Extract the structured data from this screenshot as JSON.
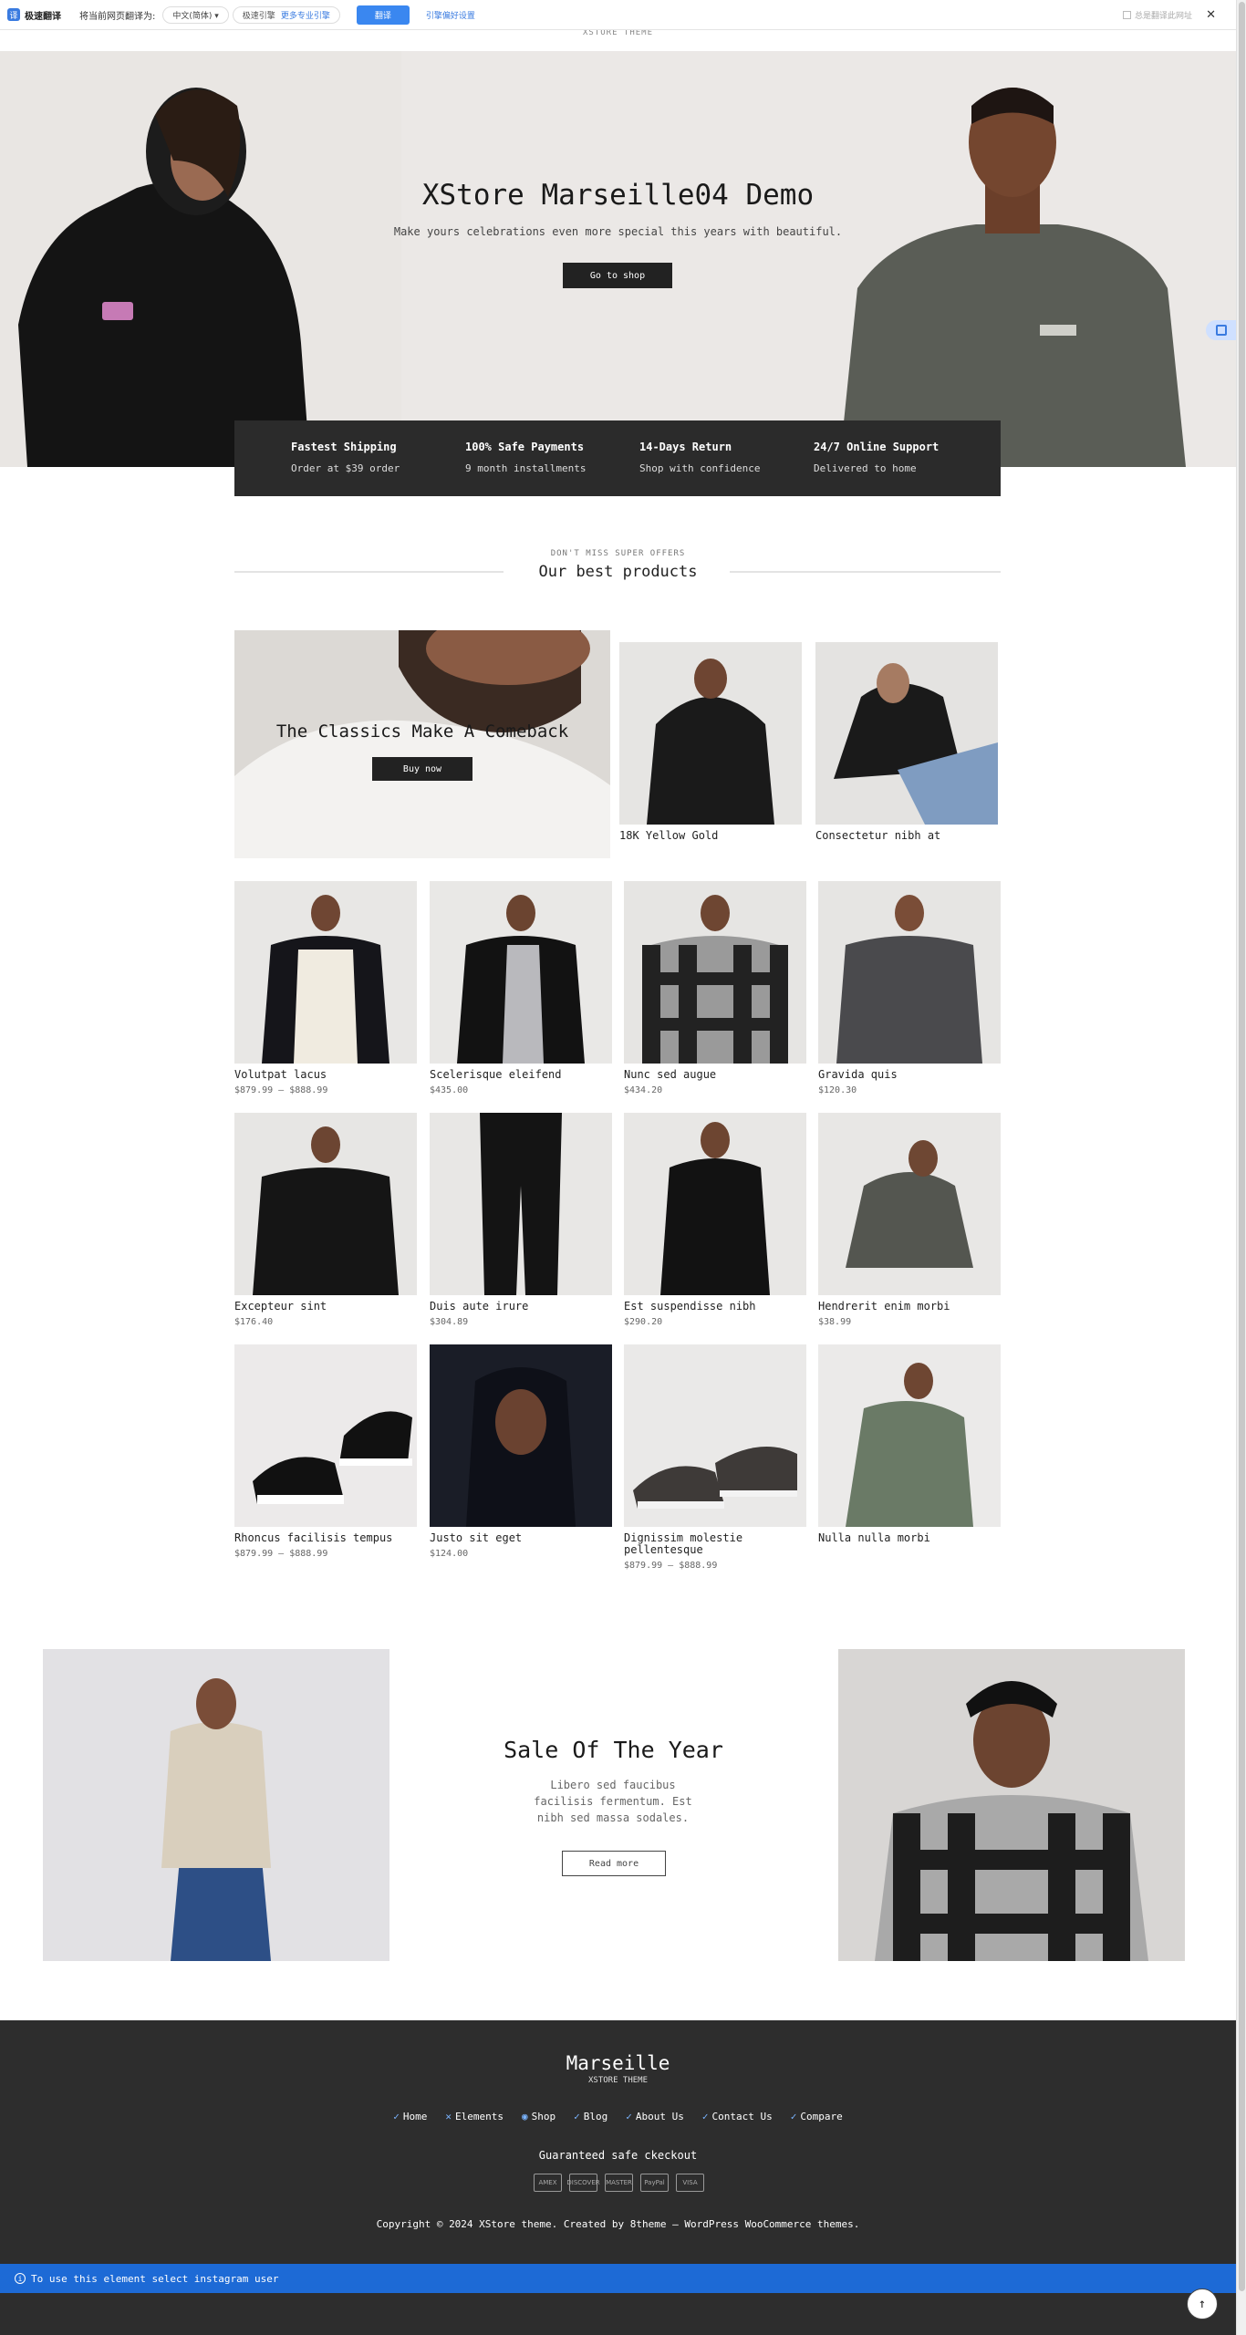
{
  "translate_bar": {
    "logo": "译",
    "brand": "极速翻译",
    "label": "将当前网页翻译为:",
    "target_language": "中文(简体)",
    "engine_label": "极速引擎",
    "engine_link": "更多专业引擎",
    "translate_button": "翻译",
    "preferences": "引擎偏好设置",
    "always_translate": "总是翻译此网址",
    "close": "✕"
  },
  "site": {
    "subtitle": "XSTORE THEME"
  },
  "hero": {
    "title": "XStore Marseille04 Demo",
    "subtitle": "Make yours celebrations even more special this years with beautiful.",
    "button": "Go to shop"
  },
  "features": [
    {
      "title": "Fastest Shipping",
      "sub": "Order at $39 order"
    },
    {
      "title": "100% Safe Payments",
      "sub": "9 month installments"
    },
    {
      "title": "14-Days Return",
      "sub": "Shop with confidence"
    },
    {
      "title": "24/7 Online Support",
      "sub": "Delivered to home"
    }
  ],
  "best": {
    "kicker": "DON'T MISS SUPER OFFERS",
    "title": "Our best products"
  },
  "promo": {
    "title": "The Classics Make A Comeback",
    "button": "Buy now"
  },
  "top_products": [
    {
      "name": "18K Yellow Gold"
    },
    {
      "name": "Consectetur nibh at"
    }
  ],
  "products": [
    {
      "name": "Volutpat lacus",
      "price": "$879.99 – $888.99"
    },
    {
      "name": "Scelerisque eleifend",
      "price": "$435.00"
    },
    {
      "name": "Nunc sed augue",
      "price": "$434.20"
    },
    {
      "name": "Gravida quis",
      "price": "$120.30"
    },
    {
      "name": "Excepteur sint",
      "price": "$176.40"
    },
    {
      "name": "Duis aute irure",
      "price": "$304.89"
    },
    {
      "name": "Est suspendisse nibh",
      "price": "$290.20"
    },
    {
      "name": "Hendrerit enim morbi",
      "price": "$38.99"
    },
    {
      "name": "Rhoncus facilisis tempus",
      "price": "$879.99 – $888.99"
    },
    {
      "name": "Justo sit eget",
      "price": "$124.00"
    },
    {
      "name": "Dignissim molestie pellentesque",
      "price": "$879.99 – $888.99"
    },
    {
      "name": "Nulla nulla morbi",
      "price": ""
    }
  ],
  "sale": {
    "title": "Sale Of The Year",
    "text": "Libero sed faucibus facilisis fermentum. Est nibh sed massa sodales.",
    "button": "Read more"
  },
  "footer": {
    "brand": "Marseille",
    "sub": "XSTORE THEME",
    "nav": [
      "Home",
      "Elements",
      "Shop",
      "Blog",
      "About Us",
      "Contact Us",
      "Compare"
    ],
    "guarantee": "Guaranteed safe ckeckout",
    "payments": [
      "AMEX",
      "DISCOVER",
      "MASTER",
      "PayPal",
      "VISA"
    ],
    "copyright": "Copyright © 2024 XStore theme. Created by 8theme – WordPress WooCommerce themes.",
    "instagram": "To use this element select instagram user"
  },
  "colors": {
    "accent": "#3a87f0",
    "dark": "#2b2b2b",
    "instagram_bar": "#1d6ad6"
  }
}
